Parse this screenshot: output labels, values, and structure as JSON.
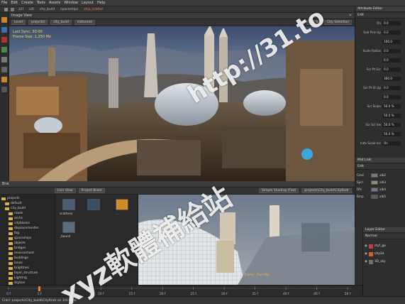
{
  "menu": [
    "File",
    "Edit",
    "Create",
    "Tools",
    "Assets",
    "Window",
    "Layout",
    "Help"
  ],
  "toolbar": {
    "items": [
      "a2l",
      "a3l",
      "city_build",
      "spaceships",
      "ship_scatter"
    ]
  },
  "viewer": {
    "title": "Image View",
    "bar_items": [
      "Level",
      "projects\\",
      "city_build",
      "instances"
    ],
    "zoom": "0.0 %",
    "selection": "City Selection",
    "overlay_line1": "Last Sync: 30:00",
    "overlay_line2": "Frame Size: 1,250 Mx"
  },
  "lower": {
    "tab": "Brw",
    "view_mode": "Icon View",
    "project_btn": "Project Brwsr",
    "shading": "Simple Shading (Flat)",
    "path": "projects\\City_build\\CityRndr",
    "frame_label": "Frame - Fscr Mio",
    "tree": [
      {
        "label": "projects",
        "indent": 0
      },
      {
        "label": "default",
        "indent": 1
      },
      {
        "label": "city_build",
        "indent": 1
      },
      {
        "label": "roads",
        "indent": 2
      },
      {
        "label": "archs",
        "indent": 2
      },
      {
        "label": "cityblocks",
        "indent": 2
      },
      {
        "label": "displacementes",
        "indent": 2
      },
      {
        "label": "fog",
        "indent": 2
      },
      {
        "label": "spaceships",
        "indent": 2
      },
      {
        "label": "objects",
        "indent": 2
      },
      {
        "label": "bridges",
        "indent": 2
      },
      {
        "label": "environment",
        "indent": 2
      },
      {
        "label": "buildings",
        "indent": 2
      },
      {
        "label": "lanes",
        "indent": 2
      },
      {
        "label": "brightnes",
        "indent": 2
      },
      {
        "label": "layer_structure",
        "indent": 2
      },
      {
        "label": "Lighting",
        "indent": 2
      },
      {
        "label": "skybox",
        "indent": 2
      },
      {
        "label": "Hidden_Scene",
        "indent": 1
      },
      {
        "label": "Scatter_Suppor",
        "indent": 1
      }
    ],
    "thumbs": [
      {
        "label": "scatterer"
      },
      {
        "label": "..."
      },
      {
        "label": "_bound"
      }
    ]
  },
  "timeline": {
    "ticks": [
      "0 f",
      "1 f",
      "5 f",
      "10 f",
      "15 f",
      "20 f",
      "25 f",
      "30 f",
      "35 f",
      "40 f",
      "45 f",
      "50 f"
    ],
    "end_label": "50 f",
    "current": 1
  },
  "status": {
    "text": "Cntrl: projects\\City_build\\CityRndr on 3/4.00hs"
  },
  "attributes": {
    "title": "Attribute Editor",
    "tab": "Edit",
    "rows": [
      {
        "label": "On",
        "value": "0.0"
      },
      {
        "label": "Sub Pxls Up",
        "value": "0.0"
      },
      {
        "label": "",
        "value": "100.0"
      },
      {
        "label": "Scale Ratios",
        "value": "0.0"
      },
      {
        "label": "",
        "value": "0.0"
      },
      {
        "label": "Scr Pt Scr",
        "value": "0.0"
      },
      {
        "label": "",
        "value": "360.0"
      },
      {
        "label": "Scr Pt St Up",
        "value": "0.0"
      },
      {
        "label": "",
        "value": "0.0"
      },
      {
        "label": "Scr Scale",
        "value": "50.0 %"
      },
      {
        "label": "",
        "value": "50.0 %"
      },
      {
        "label": "Scr Scl Vw",
        "value": "50.0 %"
      },
      {
        "label": "",
        "value": "50.0 %"
      },
      {
        "label": "Indx Scale Inc",
        "value": "On"
      }
    ]
  },
  "materials": {
    "title": "Mat Lnkr",
    "tab": "Edit",
    "rows": [
      {
        "name": "Cmd",
        "swatch": "#7a7a7a",
        "tag": "alb2"
      },
      {
        "name": "Spcl",
        "swatch": "#9a8f6a",
        "tag": "alb3"
      },
      {
        "name": "Dfs",
        "swatch": "#6a7a8a",
        "tag": "alb4"
      },
      {
        "name": "Bmp",
        "swatch": "#5a5a5a",
        "tag": "alb5"
      }
    ]
  },
  "layers": {
    "title": "Layer Editor",
    "mode": "Normal",
    "rows": [
      {
        "name": "ctyf_ge",
        "color": "#c04040"
      },
      {
        "name": "city3d",
        "color": "#d06030"
      },
      {
        "name": "3D_sky",
        "color": "#707070"
      }
    ]
  },
  "watermark": {
    "url": "http://31.to",
    "text": "xyz軟體補給站"
  }
}
